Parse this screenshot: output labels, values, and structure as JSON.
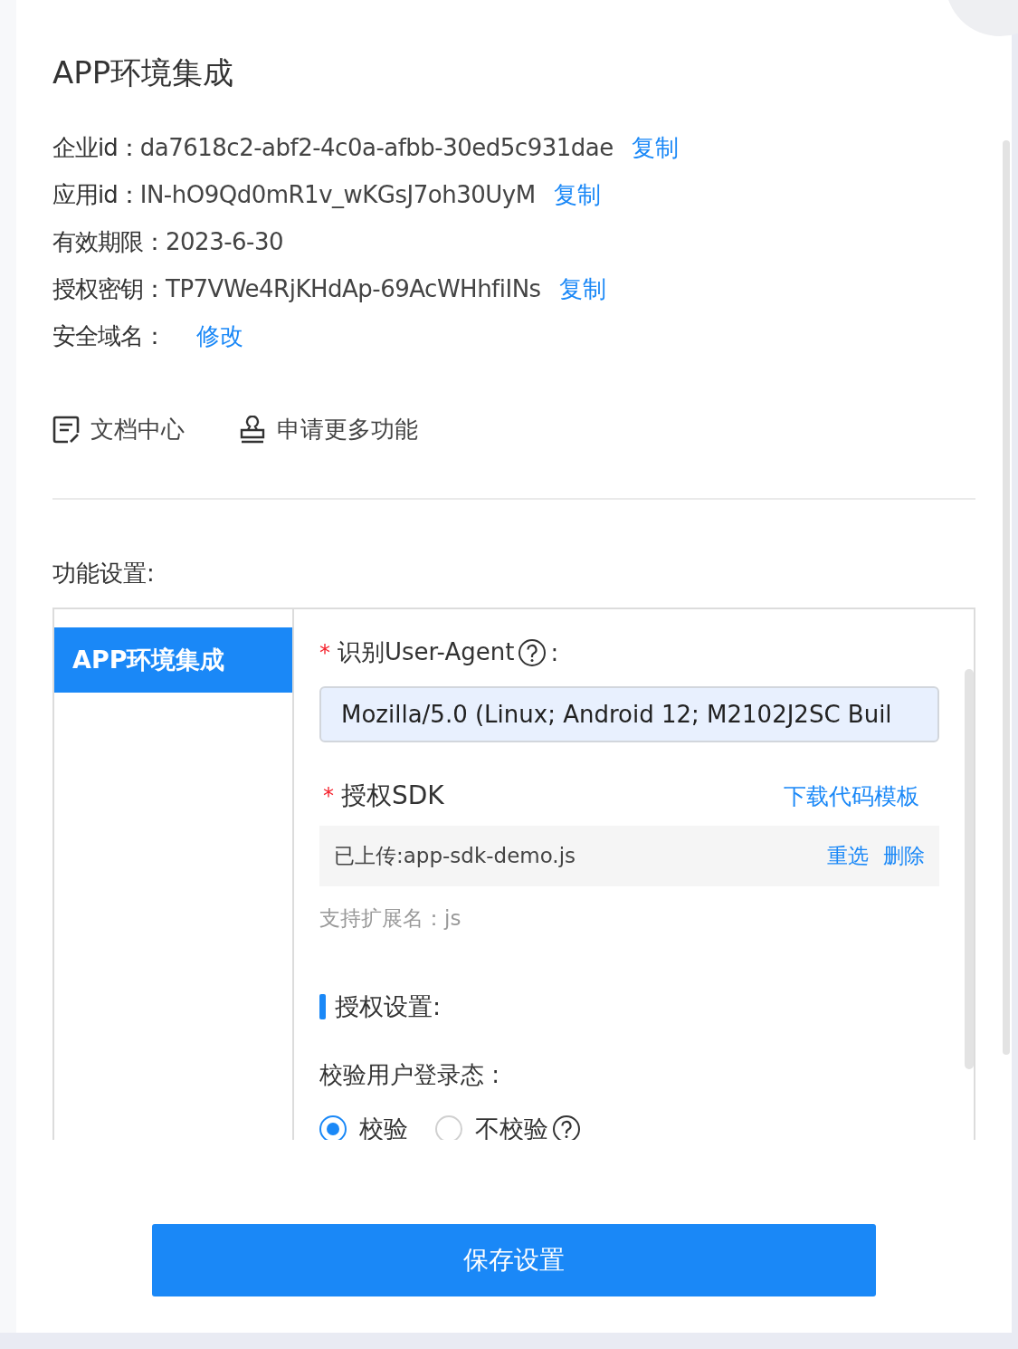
{
  "title": "APP环境集成",
  "info": [
    {
      "label": "企业id：",
      "value": "da7618c2-abf2-4c0a-afbb-30ed5c931dae",
      "action": "复制"
    },
    {
      "label": "应用id：",
      "value": "IN-hO9Qd0mR1v_wKGsJ7oh30UyM",
      "action": "复制"
    },
    {
      "label": "有效期限：",
      "value": "2023-6-30"
    },
    {
      "label": "授权密钥：",
      "value": "TP7VWe4RjKHdAp-69AcWHhfiINs",
      "action": "复制"
    },
    {
      "label": "安全域名：",
      "action": "修改"
    }
  ],
  "links": [
    {
      "kind": "doc",
      "label": "文档中心"
    },
    {
      "kind": "stamp",
      "label": "申请更多功能"
    }
  ],
  "section_title": "功能设置:",
  "menu": [
    {
      "label": "APP环境集成",
      "selected": true
    }
  ],
  "form": {
    "user_agent": {
      "marker": "*",
      "label": "识别User-Agent",
      "suffix": ":",
      "value": "Mozilla/5.0 (Linux; Android 12; M2102J2SC Buil"
    },
    "sdk": {
      "marker": "*",
      "label": "授权SDK",
      "download": "下载代码模板",
      "file": "已上传:app-sdk-demo.js",
      "actions": [
        "重选",
        "删除"
      ],
      "hint": "支持扩展名：js"
    },
    "auth_heading": "授权设置:",
    "login_check": {
      "label": "校验用户登录态 :",
      "options": [
        {
          "label": "校验",
          "selected": true,
          "help": false
        },
        {
          "label": "不校验",
          "selected": false,
          "help": true
        }
      ]
    }
  },
  "save_button": "保存设置"
}
